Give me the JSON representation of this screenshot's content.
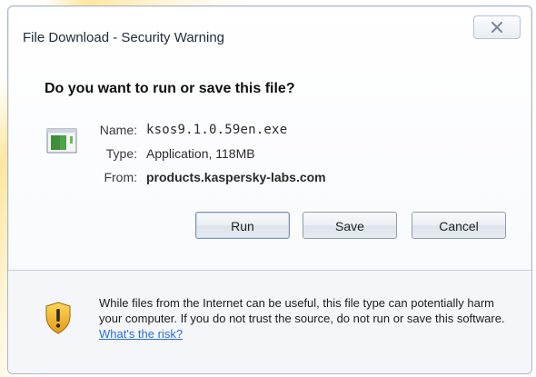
{
  "window": {
    "title": "File Download - Security Warning",
    "heading": "Do you want to run or save this file?"
  },
  "file": {
    "icon": "application-file-icon",
    "name_label": "Name:",
    "name_value": "ksos9.1.0.59en.exe",
    "type_label": "Type:",
    "type_value": "Application, 118MB",
    "from_label": "From:",
    "from_value": "products.kaspersky-labs.com"
  },
  "buttons": {
    "run": "Run",
    "save": "Save",
    "cancel": "Cancel"
  },
  "warning": {
    "icon": "security-shield-icon",
    "text": "While files from the Internet can be useful, this file type can potentially harm your computer. If you do not trust the source, do not run or save this software. ",
    "link": "What's the risk?"
  },
  "colors": {
    "link": "#2a6ed8",
    "shield": "#f0b323"
  }
}
